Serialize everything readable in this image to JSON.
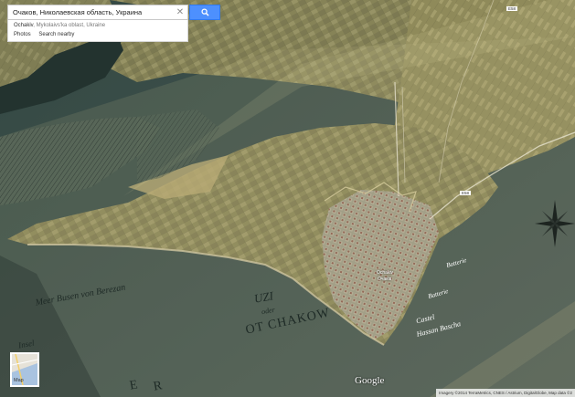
{
  "search": {
    "query": "Очаков, Николаевская область, Украина",
    "clear_icon": "close-icon",
    "search_icon": "magnifier-icon"
  },
  "result_card": {
    "title": "Ochakiv",
    "subtitle": ", Mykolaivs'ka oblast, Ukraine",
    "actions": [
      "Photos",
      "Search nearby"
    ]
  },
  "map_type_toggle": {
    "label": "Map"
  },
  "branding": {
    "logo": "Google"
  },
  "attribution": "Imagery ©2014 TerraMetrics, CNES / Astrium, DigitalGlobe, Map data ©2",
  "map_labels": {
    "road_top": "E58",
    "road_mid": "E58",
    "city": "Ochakiv",
    "city_local": "Очаків"
  },
  "historic_map_text": {
    "bay": "Meer Busen von Berezan",
    "uzi": "UZI",
    "oder": "oder",
    "otchakow": "OT CHAKOW",
    "castel": "Castel",
    "hassan": "Hassan Bascha",
    "batterie1": "Batterie",
    "batterie2": "Batterie",
    "insel": "Insel",
    "letter_e": "E",
    "letter_r": "R"
  },
  "colors": {
    "search_button": "#4d90fe",
    "sea": "#3f514c",
    "land": "#8d8a5c",
    "overlay_paper": "#c9bf8c"
  }
}
